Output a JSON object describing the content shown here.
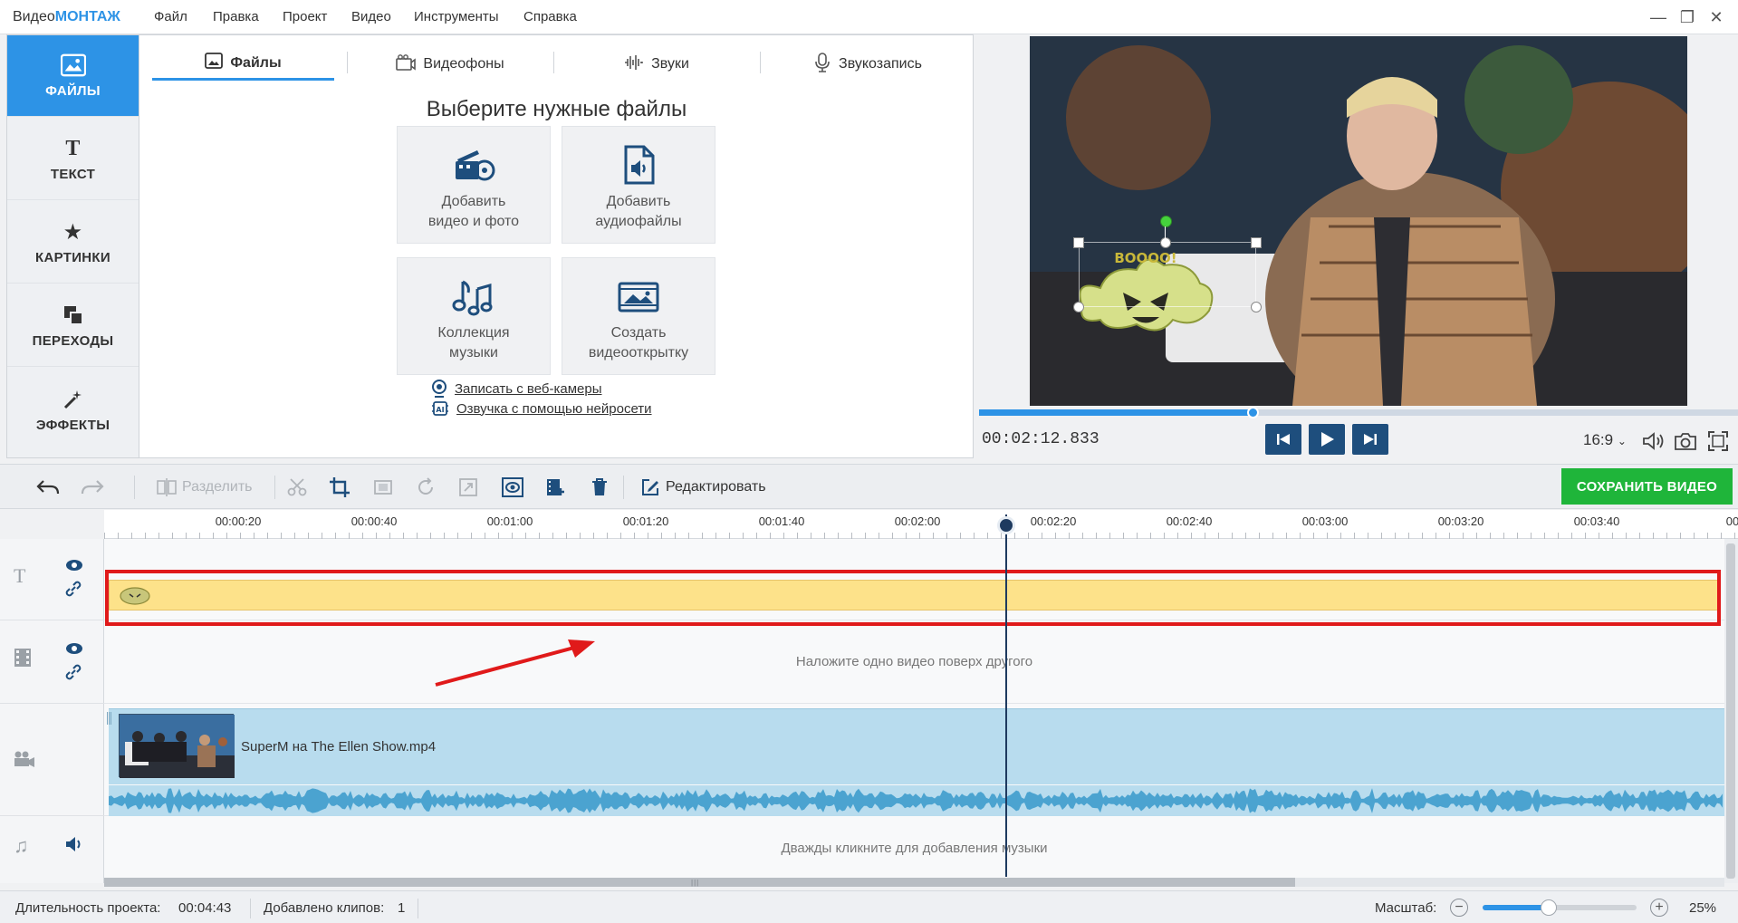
{
  "app": {
    "brand_prefix": "Видео",
    "brand_suffix": "МОНТАЖ"
  },
  "menu": [
    "Файл",
    "Правка",
    "Проект",
    "Видео",
    "Инструменты",
    "Справка"
  ],
  "sidebar": {
    "items": [
      {
        "label": "ФАЙЛЫ",
        "icon": "image-icon",
        "active": true
      },
      {
        "label": "ТЕКСТ",
        "icon": "text-icon"
      },
      {
        "label": "КАРТИНКИ",
        "icon": "star-icon"
      },
      {
        "label": "ПЕРЕХОДЫ",
        "icon": "transitions-icon"
      },
      {
        "label": "ЭФФЕКТЫ",
        "icon": "magic-wand-icon"
      }
    ]
  },
  "panel": {
    "tabs": [
      {
        "label": "Файлы",
        "icon": "image-icon",
        "active": true
      },
      {
        "label": "Видеофоны",
        "icon": "video-backgrounds-icon"
      },
      {
        "label": "Звуки",
        "icon": "waveform-icon"
      },
      {
        "label": "Звукозапись",
        "icon": "microphone-icon"
      }
    ],
    "title": "Выберите нужные файлы",
    "tiles": [
      {
        "line1": "Добавить",
        "line2": "видео и фото",
        "icon": "film-camera-icon"
      },
      {
        "line1": "Добавить",
        "line2": "аудиофайлы",
        "icon": "audio-file-icon"
      },
      {
        "line1": "Коллекция",
        "line2": "музыки",
        "icon": "music-notes-icon"
      },
      {
        "line1": "Создать",
        "line2": "видеооткрытку",
        "icon": "postcard-icon"
      }
    ],
    "links": [
      {
        "label": "Записать с веб-камеры",
        "icon": "webcam-icon"
      },
      {
        "label": "Озвучка с помощью нейросети",
        "icon": "ai-icon"
      }
    ]
  },
  "preview": {
    "timecode": "00:02:12.833",
    "progress": 0.36,
    "aspect": "16:9",
    "sticker_text": "BOOOO!"
  },
  "toolbar": {
    "split": "Разделить",
    "edit": "Редактировать",
    "save": "СОХРАНИТЬ ВИДЕО"
  },
  "ruler": {
    "ticks": [
      "00:00:20",
      "00:00:40",
      "00:01:00",
      "00:01:20",
      "00:01:40",
      "00:02:00",
      "00:02:20",
      "00:02:40",
      "00:03:00",
      "00:03:20",
      "00:03:40",
      "00"
    ]
  },
  "timeline": {
    "overlay_hint": "Наложите одно видео поверх другого",
    "clip_name": "SuperM на The Ellen Show.mp4",
    "music_hint": "Дважды кликните для добавления музыки",
    "playhead_position": "00:02:12.833"
  },
  "status": {
    "duration_label": "Длительность проекта:",
    "duration_value": "00:04:43",
    "clips_label": "Добавлено клипов:",
    "clips_value": "1",
    "scale_label": "Масштаб:",
    "scale_value": "25%",
    "scale_fraction": 0.43
  },
  "colors": {
    "accent": "#2d93e6",
    "save": "#1fb53a",
    "highlight": "#e01a1a",
    "overlay_clip": "#fde28a",
    "main_clip": "#b8dcee"
  }
}
